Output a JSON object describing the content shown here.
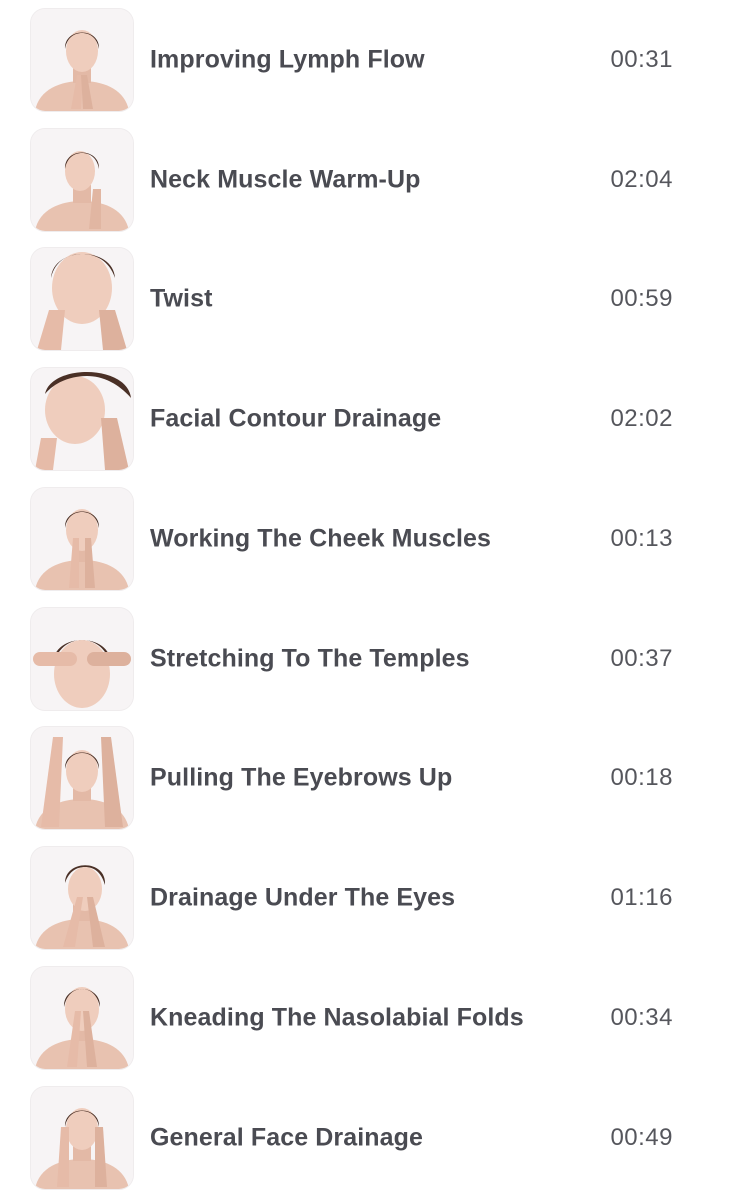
{
  "exercises": [
    {
      "title": "Improving Lymph Flow",
      "duration": "00:31",
      "thumbnail": "woman-hands-under-chin-image"
    },
    {
      "title": "Neck Muscle Warm-Up",
      "duration": "02:04",
      "thumbnail": "woman-hand-on-neck-image"
    },
    {
      "title": "Twist",
      "duration": "00:59",
      "thumbnail": "woman-fingers-on-cheeks-image"
    },
    {
      "title": "Facial Contour Drainage",
      "duration": "02:02",
      "thumbnail": "woman-jawline-massage-image"
    },
    {
      "title": "Working The Cheek Muscles",
      "duration": "00:13",
      "thumbnail": "woman-fingers-at-mouth-image"
    },
    {
      "title": "Stretching To The Temples",
      "duration": "00:37",
      "thumbnail": "woman-fingers-on-forehead-image"
    },
    {
      "title": "Pulling The Eyebrows Up",
      "duration": "00:18",
      "thumbnail": "woman-hands-above-brows-image"
    },
    {
      "title": "Drainage Under The Eyes",
      "duration": "01:16",
      "thumbnail": "woman-fingers-under-eyes-image"
    },
    {
      "title": "Kneading The Nasolabial Folds",
      "duration": "00:34",
      "thumbnail": "woman-fingers-beside-nose-image"
    },
    {
      "title": "General Face Drainage",
      "duration": "00:49",
      "thumbnail": "woman-palms-on-face-image"
    }
  ]
}
